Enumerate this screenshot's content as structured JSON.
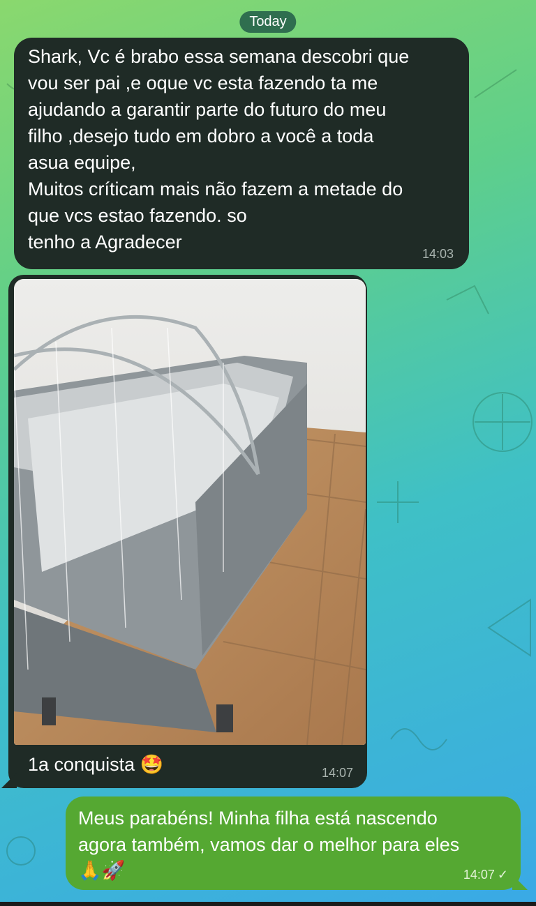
{
  "date_divider": "Today",
  "messages": [
    {
      "direction": "incoming",
      "lines": [
        "Shark, Vc é brabo essa semana descobri que",
        "vou ser pai ,e oque vc esta fazendo ta me",
        "ajudando a garantir parte do futuro do meu",
        "filho ,desejo tudo em dobro a você a toda",
        "asua equipe,",
        "Muitos críticam mais não fazem a metade do",
        "que vcs estao fazendo. so",
        "tenho a Agradecer"
      ],
      "time": "14:03"
    },
    {
      "direction": "incoming",
      "photo_description": "baby playpen with mosquito net on tiled floor",
      "caption": "1a conquista",
      "caption_emoji": "🤩",
      "time": "14:07"
    },
    {
      "direction": "outgoing",
      "lines": [
        "Meus parabéns! Minha filha está nascendo",
        "agora também, vamos dar o melhor para eles"
      ],
      "emojis": "🙏🚀",
      "time": "14:07",
      "status_icon": "double-check-icon"
    }
  ],
  "colors": {
    "incoming_bubble": "#1f2b26",
    "outgoing_bubble": "#55a832",
    "date_pill": "#2f6e4f"
  }
}
